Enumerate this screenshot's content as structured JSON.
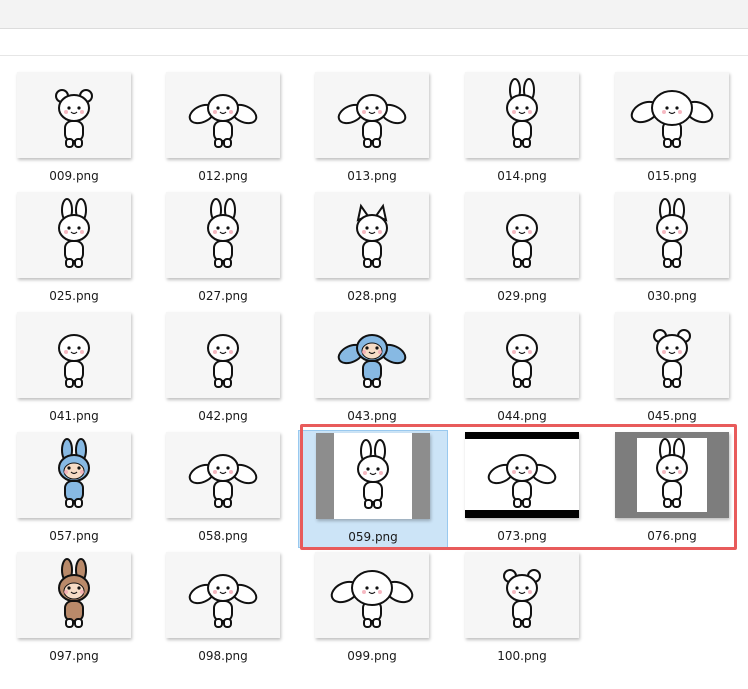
{
  "files": [
    {
      "name": "009.png",
      "style": "plain",
      "char": "bear"
    },
    {
      "name": "012.png",
      "style": "plain",
      "char": "dog"
    },
    {
      "name": "013.png",
      "style": "plain",
      "char": "dog"
    },
    {
      "name": "014.png",
      "style": "plain",
      "char": "bunny"
    },
    {
      "name": "015.png",
      "style": "plain",
      "char": "dog-big"
    },
    {
      "name": "025.png",
      "style": "plain",
      "char": "bunny"
    },
    {
      "name": "027.png",
      "style": "plain",
      "char": "bunny"
    },
    {
      "name": "028.png",
      "style": "plain",
      "char": "cat"
    },
    {
      "name": "029.png",
      "style": "plain",
      "char": "round"
    },
    {
      "name": "030.png",
      "style": "plain",
      "char": "bunny"
    },
    {
      "name": "041.png",
      "style": "plain",
      "char": "round"
    },
    {
      "name": "042.png",
      "style": "plain",
      "char": "round"
    },
    {
      "name": "043.png",
      "style": "plain",
      "char": "blue-dog"
    },
    {
      "name": "044.png",
      "style": "plain",
      "char": "round"
    },
    {
      "name": "045.png",
      "style": "plain",
      "char": "bear"
    },
    {
      "name": "057.png",
      "style": "plain",
      "char": "blue-bunny"
    },
    {
      "name": "058.png",
      "style": "plain",
      "char": "dog"
    },
    {
      "name": "059.png",
      "style": "dark",
      "char": "bunny",
      "selected": true
    },
    {
      "name": "073.png",
      "style": "bars",
      "char": "dog"
    },
    {
      "name": "076.png",
      "style": "gray2",
      "char": "bunny"
    },
    {
      "name": "097.png",
      "style": "plain",
      "char": "brown-bunny"
    },
    {
      "name": "098.png",
      "style": "plain",
      "char": "dog"
    },
    {
      "name": "099.png",
      "style": "plain",
      "char": "dog-big"
    },
    {
      "name": "100.png",
      "style": "plain",
      "char": "bear"
    }
  ]
}
